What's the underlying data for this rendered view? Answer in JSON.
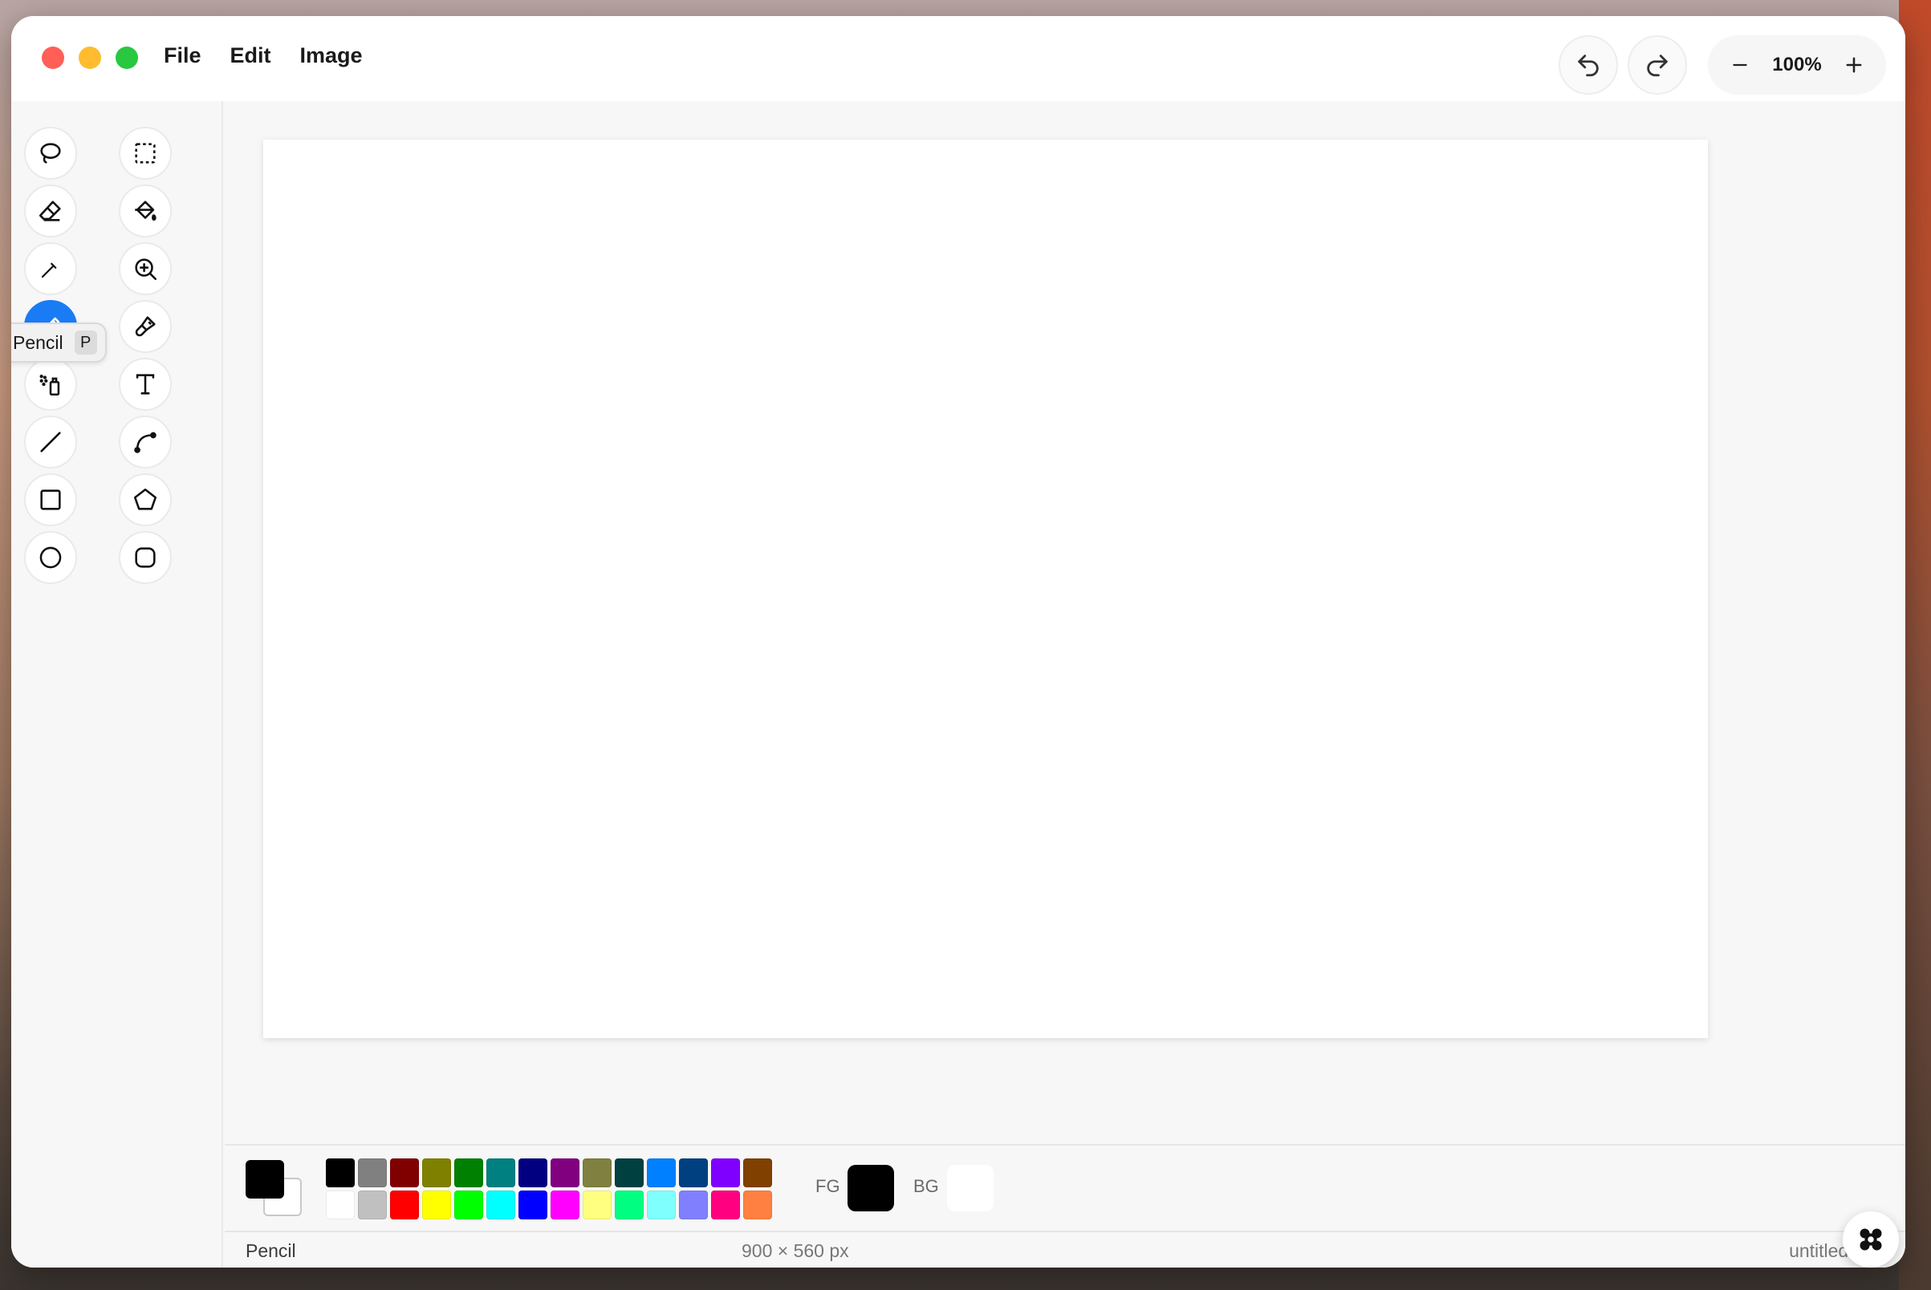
{
  "menu": {
    "file": "File",
    "edit": "Edit",
    "image": "Image"
  },
  "zoom": {
    "value": "100%"
  },
  "tooltip": {
    "label": "Pencil",
    "shortcut": "P"
  },
  "tools": [
    {
      "icon": "lasso-icon"
    },
    {
      "icon": "rect-select-icon"
    },
    {
      "icon": "eraser-icon"
    },
    {
      "icon": "fill-bucket-icon"
    },
    {
      "icon": "color-picker-icon"
    },
    {
      "icon": "zoom-icon"
    },
    {
      "icon": "pencil-icon",
      "active": true
    },
    {
      "icon": "brush-icon"
    },
    {
      "icon": "airbrush-icon"
    },
    {
      "icon": "text-icon"
    },
    {
      "icon": "line-icon"
    },
    {
      "icon": "curve-icon"
    },
    {
      "icon": "rectangle-icon"
    },
    {
      "icon": "polygon-icon"
    },
    {
      "icon": "ellipse-icon"
    },
    {
      "icon": "rounded-rect-icon"
    }
  ],
  "palette": {
    "row1": [
      "#000000",
      "#808080",
      "#800000",
      "#808000",
      "#008000",
      "#008080",
      "#000080",
      "#800080",
      "#808040",
      "#004040",
      "#0080ff",
      "#004080",
      "#8000ff",
      "#804000"
    ],
    "row2": [
      "#ffffff",
      "#c0c0c0",
      "#ff0000",
      "#ffff00",
      "#00ff00",
      "#00ffff",
      "#0000ff",
      "#ff00ff",
      "#ffff80",
      "#00ff80",
      "#80ffff",
      "#8080ff",
      "#ff0080",
      "#ff8040"
    ]
  },
  "colors": {
    "fg_label": "FG",
    "bg_label": "BG",
    "fg": "#000000",
    "bg": "#ffffff",
    "accent": "#1a7cf5"
  },
  "status": {
    "tool": "Pencil",
    "dimensions": "900 × 560 px",
    "filename": "untitled.png"
  }
}
